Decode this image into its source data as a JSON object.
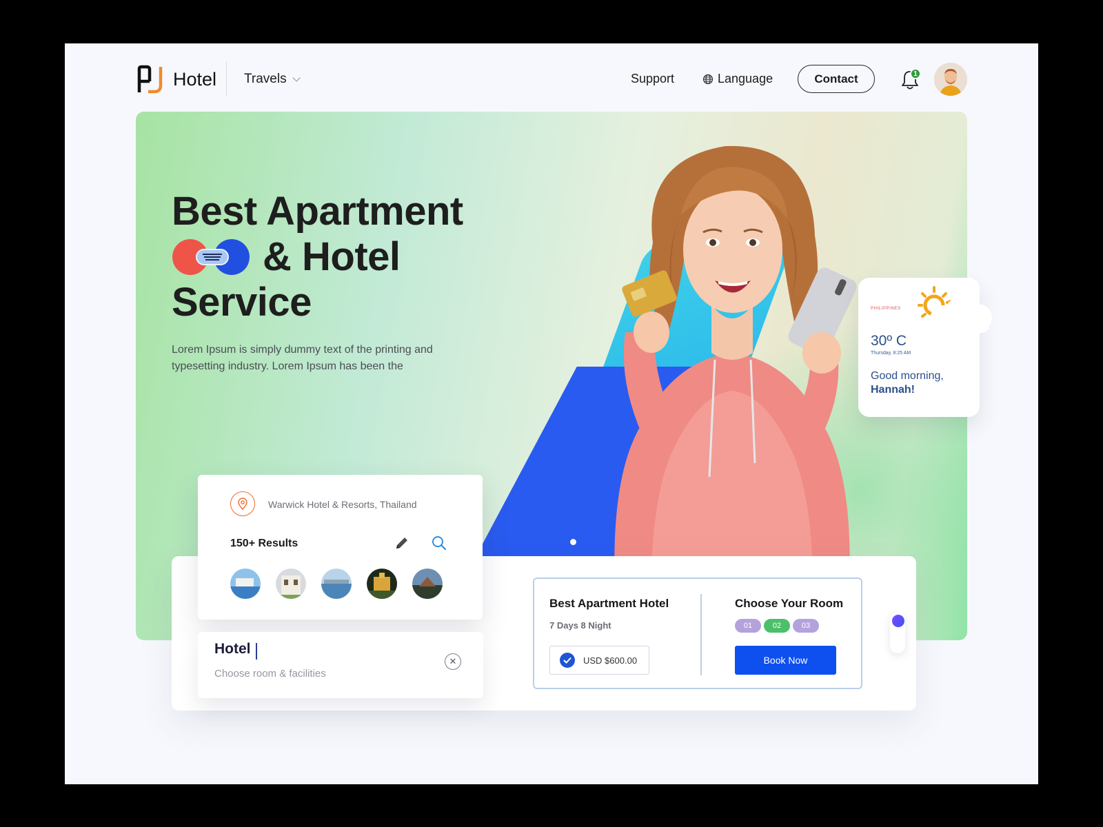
{
  "header": {
    "brand": "Hotel",
    "nav_travels": "Travels",
    "nav_support": "Support",
    "nav_language": "Language",
    "contact_label": "Contact",
    "notification_count": "1"
  },
  "hero": {
    "title_line1": "Best Apartment",
    "title_line2": "& Hotel",
    "title_line3": "Service",
    "description": "Lorem Ipsum is simply dummy text of the printing and typesetting industry. Lorem Ipsum has been the"
  },
  "weather": {
    "country": "PHILIPPINES",
    "temperature": "30º C",
    "datetime": "Thursday, 8:25 AM",
    "greeting": "Good morning,",
    "name": "Hannah!"
  },
  "results": {
    "location": "Warwick Hotel & Resorts, Thailand",
    "count": "150+ Results",
    "thumbnails": [
      "resort-pool",
      "white-villa",
      "waterfront-city",
      "night-palace",
      "sunset-house"
    ]
  },
  "search": {
    "value": "Hotel",
    "subtitle": "Choose room & facilities"
  },
  "offer": {
    "title": "Best Apartment Hotel",
    "duration": "7 Days 8 Night",
    "price": "USD $600.00",
    "room_title": "Choose Your Room",
    "rooms": [
      "01",
      "02",
      "03"
    ],
    "book_label": "Book Now"
  },
  "colors": {
    "primary": "#0e4ff0",
    "accent_orange": "#ef8c2b",
    "room_tab_inactive": "#b3a2db",
    "room_tab_active": "#4cbf6a"
  }
}
